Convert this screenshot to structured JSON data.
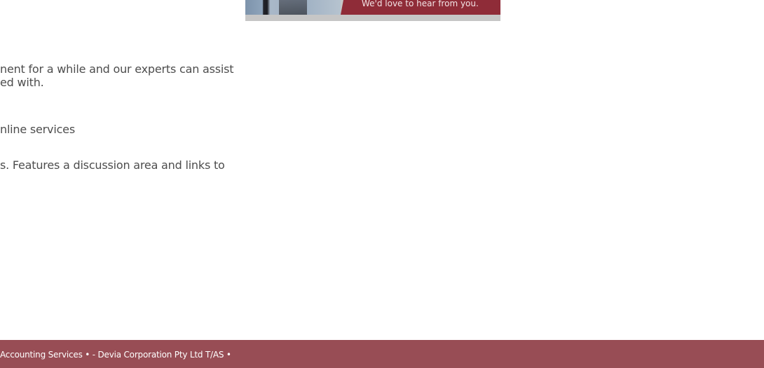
{
  "contact_banner": {
    "cta_text": "We'd love to hear from you.",
    "colors": {
      "cta_background": "#8f2c38",
      "frame": "#c6c6c6"
    }
  },
  "content": {
    "lines": [
      "nent for a while and our experts can assist",
      "ed with.",
      "nline services",
      "s. Features a discussion area and links to"
    ]
  },
  "footer": {
    "text": "Accounting Services • - Devia Corporation Pty Ltd T/AS •",
    "background": "#984d55"
  }
}
